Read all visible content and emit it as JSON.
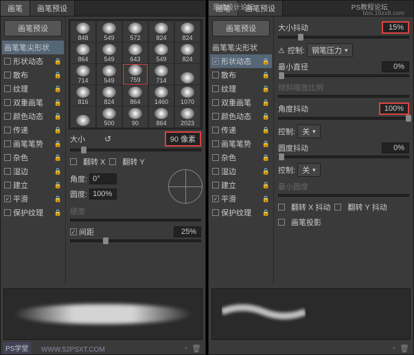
{
  "watermarks": {
    "logo": "PS学堂",
    "url1": "WWW.52PSXT.COM",
    "forum": "思缘设计论坛",
    "tutorial": "PS教程论坛",
    "bbs": "bbs.16xx8.com"
  },
  "tabs": {
    "brush": "画笔",
    "presets": "画笔预设"
  },
  "sidebar": {
    "presetBtn": "画笔预设",
    "tipShape": "画笔笔尖形状",
    "shapeDynamics": "形状动态",
    "scattering": "散布",
    "texture": "纹理",
    "dualBrush": "双重画笔",
    "colorDynamics": "颜色动态",
    "transfer": "传递",
    "brushPose": "画笔笔势",
    "noise": "杂色",
    "wetEdges": "湿边",
    "buildup": "建立",
    "smoothing": "平滑",
    "protectTexture": "保护纹理"
  },
  "brushGrid": [
    [
      "848",
      "549",
      "572",
      "824",
      "824"
    ],
    [
      "864",
      "549",
      "643",
      "549",
      "824"
    ],
    [
      "714",
      "549",
      "759",
      "714",
      ""
    ],
    [
      "816",
      "824",
      "864",
      "1460",
      "1070"
    ],
    [
      "",
      "500",
      "90",
      "864",
      "2023"
    ]
  ],
  "brushSelected": [
    2,
    2
  ],
  "leftControls": {
    "sizeLabel": "大小",
    "sizeValue": "90 像素",
    "flipXLabel": "翻转 X",
    "flipYLabel": "翻转 Y",
    "angleLabel": "角度:",
    "angleValue": "0°",
    "roundnessLabel": "圆度:",
    "roundnessValue": "100%",
    "hardnessLabel": "硬度",
    "spacingLabel": "间距",
    "spacingValue": "25%"
  },
  "rightControls": {
    "sizeJitterLabel": "大小抖动",
    "sizeJitterValue": "15%",
    "controlLabel": "控制:",
    "penPressure": "钢笔压力",
    "minDiameterLabel": "最小直径",
    "minDiameterValue": "0%",
    "tiltScaleLabel": "倾斜缩放比例",
    "angleJitterLabel": "角度抖动",
    "angleJitterValue": "100%",
    "offOption": "关",
    "roundnessJitterLabel": "圆度抖动",
    "roundnessJitterValue": "0%",
    "minRoundnessLabel": "最小圆度",
    "flipXJitterLabel": "翻转 X 抖动",
    "flipYJitterLabel": "翻转 Y 抖动",
    "brushProjectionLabel": "画笔投影"
  }
}
